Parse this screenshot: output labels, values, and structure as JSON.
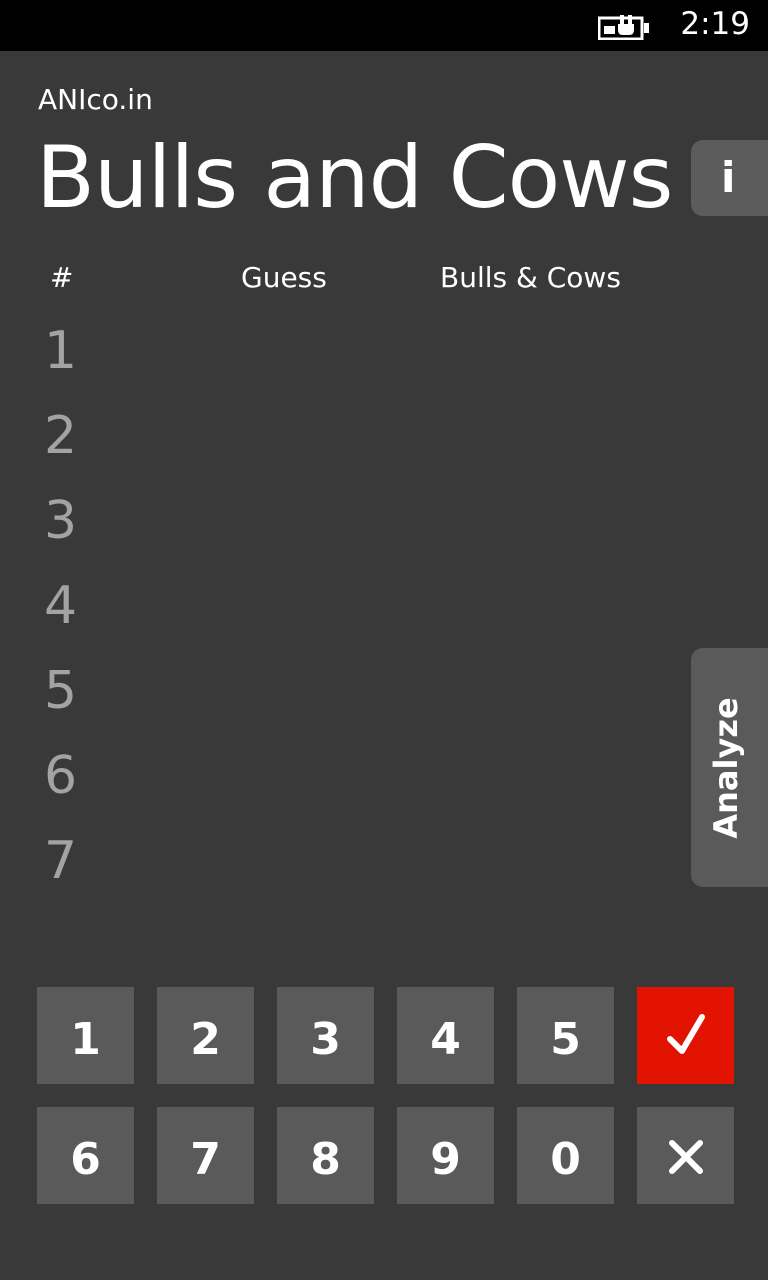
{
  "status_bar": {
    "time": "2:19",
    "battery_icon": "battery-charging-icon"
  },
  "header": {
    "app_name": "ANIco.in",
    "title": "Bulls and Cows",
    "info_label": "i"
  },
  "table": {
    "columns": [
      "#",
      "Guess",
      "Bulls & Cows"
    ],
    "row_numbers": [
      "1",
      "2",
      "3",
      "4",
      "5",
      "6",
      "7"
    ]
  },
  "analyze": {
    "label": "Analyze"
  },
  "keypad": {
    "row1": [
      "1",
      "2",
      "3",
      "4",
      "5"
    ],
    "row2": [
      "6",
      "7",
      "8",
      "9",
      "0"
    ],
    "submit_icon": "check-icon",
    "clear_icon": "close-icon",
    "submit_color": "#e21300",
    "key_color": "#5a5a5a"
  }
}
